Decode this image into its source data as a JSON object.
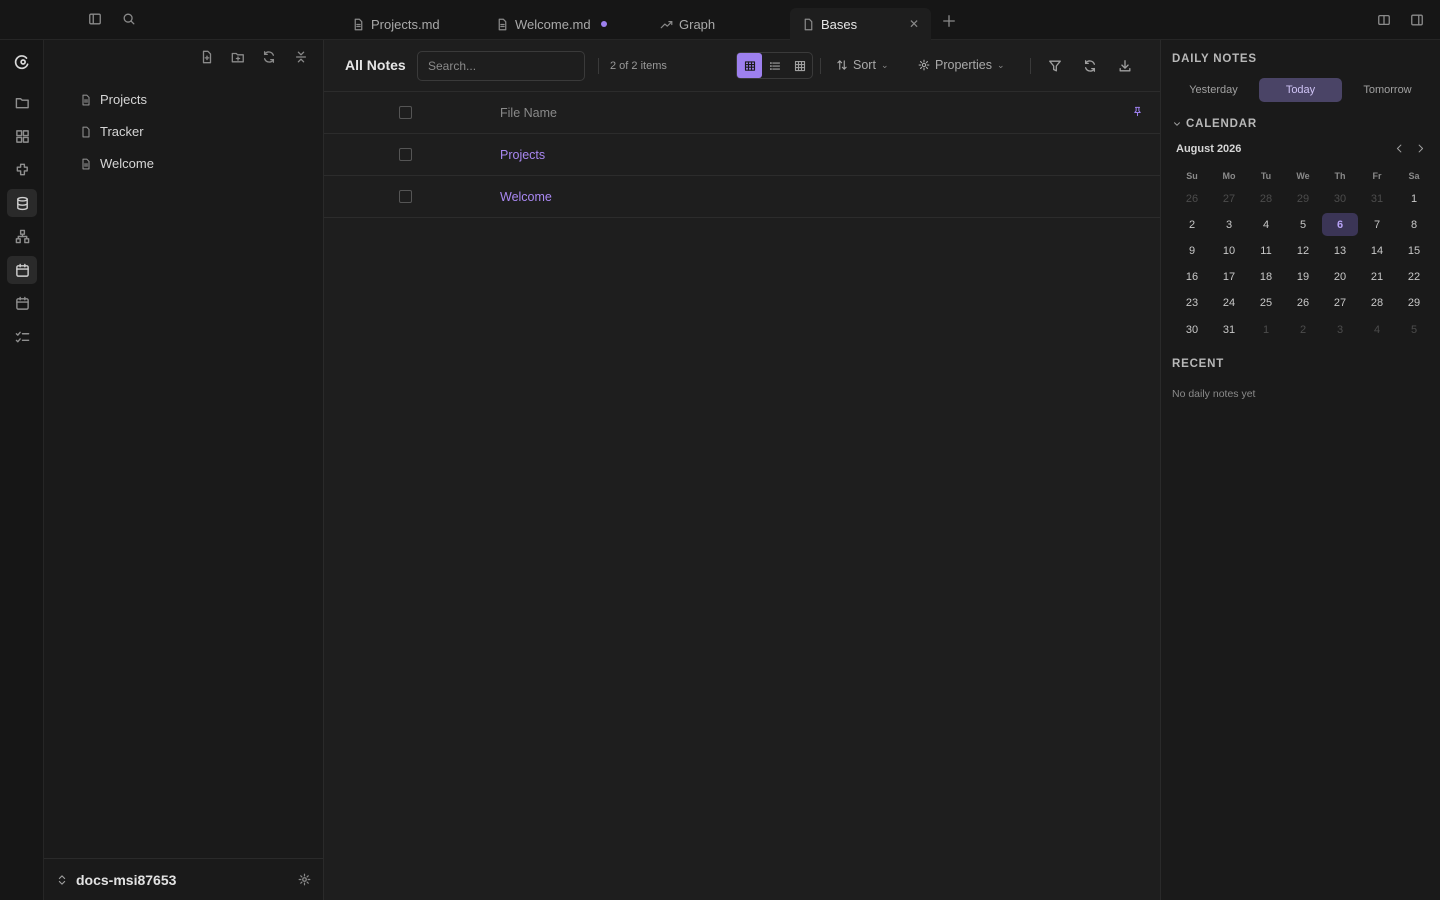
{
  "tabs": [
    {
      "label": "Projects.md",
      "icon": "file-icon"
    },
    {
      "label": "Welcome.md",
      "icon": "file-icon",
      "unsaved": true
    },
    {
      "label": "Graph",
      "icon": "graph-icon"
    },
    {
      "label": "Bases",
      "icon": "file-icon",
      "active": true
    }
  ],
  "explorer": {
    "files": [
      "Projects",
      "Tracker",
      "Welcome"
    ],
    "vault_name": "docs-msi87653"
  },
  "bases": {
    "view_title": "All Notes",
    "search_placeholder": "Search...",
    "count": "2 of 2 items",
    "sort_label": "Sort",
    "properties_label": "Properties",
    "column_header": "File Name",
    "rows": [
      "Projects",
      "Welcome"
    ],
    "active_view": "table"
  },
  "daily_notes": {
    "title": "DAILY NOTES",
    "nav": [
      "Yesterday",
      "Today",
      "Tomorrow"
    ],
    "active": "Today",
    "calendar_title": "CALENDAR",
    "month": "August 2026",
    "weekdays": [
      "Su",
      "Mo",
      "Tu",
      "We",
      "Th",
      "Fr",
      "Sa"
    ],
    "weeks": [
      [
        {
          "d": "26",
          "o": true
        },
        {
          "d": "27",
          "o": true
        },
        {
          "d": "28",
          "o": true
        },
        {
          "d": "29",
          "o": true
        },
        {
          "d": "30",
          "o": true
        },
        {
          "d": "31",
          "o": true
        },
        {
          "d": "1"
        }
      ],
      [
        {
          "d": "2"
        },
        {
          "d": "3"
        },
        {
          "d": "4"
        },
        {
          "d": "5"
        },
        {
          "d": "6",
          "t": true
        },
        {
          "d": "7"
        },
        {
          "d": "8"
        }
      ],
      [
        {
          "d": "9"
        },
        {
          "d": "10"
        },
        {
          "d": "11"
        },
        {
          "d": "12"
        },
        {
          "d": "13"
        },
        {
          "d": "14"
        },
        {
          "d": "15"
        }
      ],
      [
        {
          "d": "16"
        },
        {
          "d": "17"
        },
        {
          "d": "18"
        },
        {
          "d": "19"
        },
        {
          "d": "20"
        },
        {
          "d": "21"
        },
        {
          "d": "22"
        }
      ],
      [
        {
          "d": "23"
        },
        {
          "d": "24"
        },
        {
          "d": "25"
        },
        {
          "d": "26"
        },
        {
          "d": "27"
        },
        {
          "d": "28"
        },
        {
          "d": "29"
        }
      ],
      [
        {
          "d": "30"
        },
        {
          "d": "31"
        },
        {
          "d": "1",
          "o": true
        },
        {
          "d": "2",
          "o": true
        },
        {
          "d": "3",
          "o": true
        },
        {
          "d": "4",
          "o": true
        },
        {
          "d": "5",
          "o": true
        }
      ]
    ],
    "recent_title": "RECENT",
    "recent_empty": "No daily notes yet"
  },
  "colors": {
    "accent": "#9d80ee",
    "link": "#a988f2",
    "bg": "#1e1e1e",
    "panel": "#1a1a1a"
  }
}
